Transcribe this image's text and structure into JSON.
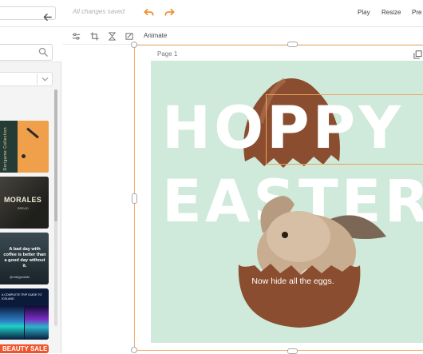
{
  "header": {
    "save_status": "All changes saved",
    "play_label": "Play",
    "resize_label": "Resize",
    "present_label": "Pre"
  },
  "sidebar": {
    "templates": [
      {
        "name": "template-stationery",
        "title": "Dorigame Collection"
      },
      {
        "name": "template-morales",
        "title": "MORALES",
        "subtitle": "BREAD"
      },
      {
        "name": "template-coffee",
        "title": "A bad day with coffee is better than a good day without it.",
        "subtitle": "@reallygreatsite"
      },
      {
        "name": "template-travel",
        "title": "A COMPLETE TRIP GUIDE TO ICELAND"
      },
      {
        "name": "template-beauty",
        "title": "BEAUTY SALE"
      }
    ]
  },
  "toolbar": {
    "animate_label": "Animate"
  },
  "canvas": {
    "page_label": "Page 1",
    "headline_line1": "HOPPY",
    "headline_line2": "EASTER",
    "tagline": "Now hide all the eggs.",
    "background_color": "#cfe9da",
    "accent_color": "#f0ad72"
  },
  "icons": [
    "undo-icon",
    "redo-icon",
    "back-arrow-icon",
    "search-icon",
    "chevron-down-icon",
    "adjust-icon",
    "crop-icon",
    "flip-icon",
    "animate-icon",
    "copy-page-icon"
  ]
}
